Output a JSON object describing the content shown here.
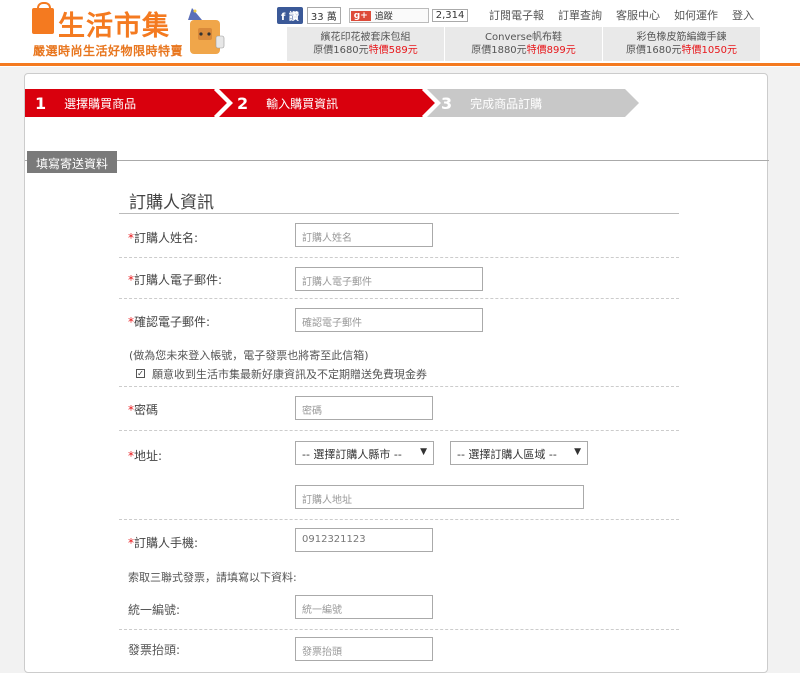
{
  "header": {
    "logo_title": "生活市集",
    "logo_slogan": "嚴選時尚生活好物限時特賣",
    "facebook": {
      "label": "讚",
      "count": "33 萬"
    },
    "gplus": {
      "label": "追蹤",
      "count": "2,314"
    },
    "top_links": [
      "訂閱電子報",
      "訂單查詢",
      "客服中心",
      "如何運作",
      "登入"
    ],
    "deals": [
      {
        "name": "繽花印花被套床包組",
        "original": "原價1680元",
        "sale": "特價589元"
      },
      {
        "name": "Converse帆布鞋",
        "original": "原價1880元",
        "sale": "特價899元"
      },
      {
        "name": "彩色橡皮筋編織手鍊",
        "original": "原價1680元",
        "sale": "特價1050元"
      }
    ]
  },
  "steps": [
    {
      "num": "1",
      "label": "選擇購買商品"
    },
    {
      "num": "2",
      "label": "輸入購買資訊"
    },
    {
      "num": "3",
      "label": "完成商品訂購"
    }
  ],
  "form": {
    "section_tag": "填寫寄送資料",
    "subtitle": "訂購人資訊",
    "name_label": "訂購人姓名:",
    "name_placeholder": "訂購人姓名",
    "email_label": "訂購人電子郵件:",
    "email_placeholder": "訂購人電子郵件",
    "confirm_email_label": "確認電子郵件:",
    "confirm_email_placeholder": "確認電子郵件",
    "note": "(做為您未來登入帳號，電子發票也將寄至此信箱)",
    "checkbox_label": "願意收到生活市集最新好康資訊及不定期贈送免費現金券",
    "password_label": "密碼",
    "password_placeholder": "密碼",
    "address_label": "地址:",
    "city_select": "-- 選擇訂購人縣市 --",
    "district_select": "-- 選擇訂購人區域 --",
    "address_placeholder": "訂購人地址",
    "mobile_label": "訂購人手機:",
    "mobile_placeholder": "0912321123",
    "invoice_note": "索取三聯式發票，請填寫以下資料:",
    "tax_id_label": "統一編號:",
    "tax_id_placeholder": "統一編號",
    "invoice_title_label": "發票抬頭:",
    "invoice_title_placeholder": "發票抬頭"
  }
}
